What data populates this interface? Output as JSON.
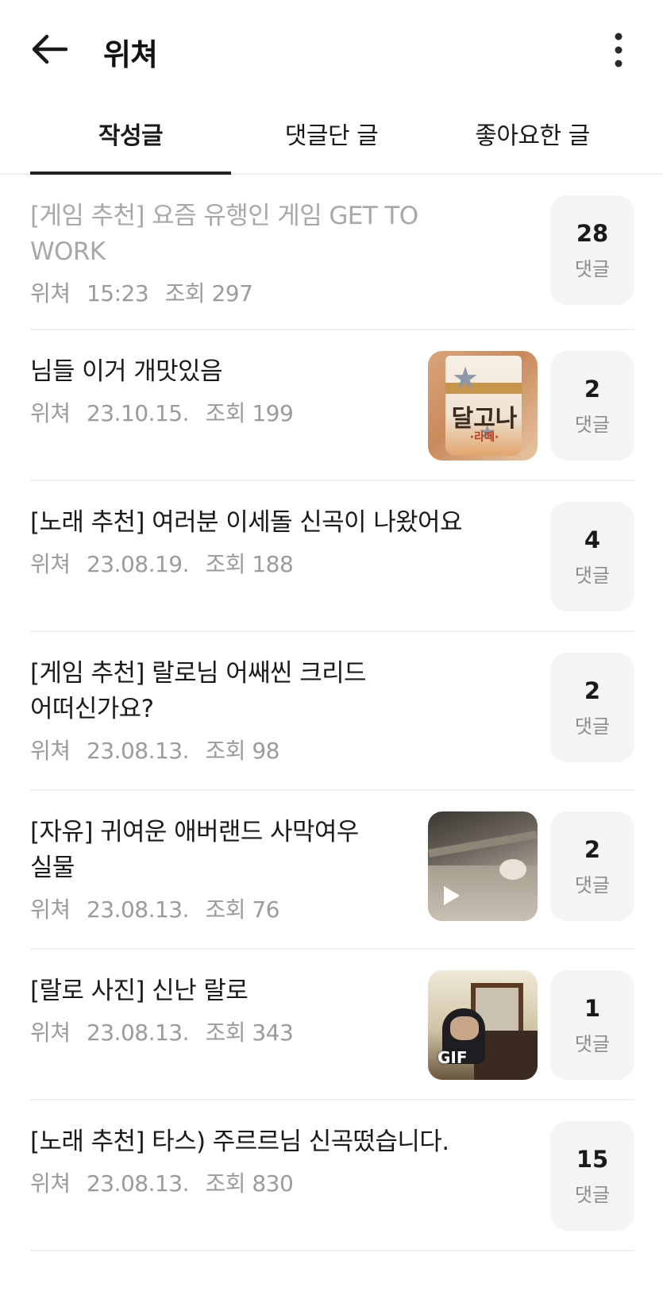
{
  "header": {
    "title": "위쳐",
    "back_icon": "arrow-left-icon",
    "more_icon": "more-vertical-icon"
  },
  "tabs": [
    {
      "label": "작성글",
      "active": true
    },
    {
      "label": "댓글단 글",
      "active": false
    },
    {
      "label": "좋아요한 글",
      "active": false
    }
  ],
  "posts": [
    {
      "title_lines": [
        "[게임 추천] 요즘 유행인 게임 GET TO",
        "WORK"
      ],
      "author": "위쳐",
      "date": "15:23",
      "views": "조회 297",
      "comments": "28",
      "comments_label": "댓글",
      "read": true,
      "thumbnail": null
    },
    {
      "title_lines": [
        "님들 이거 개맛있음"
      ],
      "author": "위쳐",
      "date": "23.10.15.",
      "views": "조회 199",
      "comments": "2",
      "comments_label": "댓글",
      "read": false,
      "thumbnail": {
        "kind": "photo",
        "text": "달고나",
        "subtext": "·라떼·"
      }
    },
    {
      "title_lines": [
        "[노래 추천] 여러분 이세돌 신곡이 나왔어요"
      ],
      "author": "위쳐",
      "date": "23.08.19.",
      "views": "조회 188",
      "comments": "4",
      "comments_label": "댓글",
      "read": false,
      "thumbnail": null
    },
    {
      "title_lines": [
        "[게임 추천] 랄로님 어쌔씬 크리드",
        "어떠신가요?"
      ],
      "author": "위쳐",
      "date": "23.08.13.",
      "views": "조회 98",
      "comments": "2",
      "comments_label": "댓글",
      "read": false,
      "thumbnail": null
    },
    {
      "title_lines": [
        "[자유] 귀여운 애버랜드 사막여우",
        "실물"
      ],
      "author": "위쳐",
      "date": "23.08.13.",
      "views": "조회 76",
      "comments": "2",
      "comments_label": "댓글",
      "read": false,
      "thumbnail": {
        "kind": "video"
      }
    },
    {
      "title_lines": [
        "[랄로 사진] 신난 랄로"
      ],
      "author": "위쳐",
      "date": "23.08.13.",
      "views": "조회 343",
      "comments": "1",
      "comments_label": "댓글",
      "read": false,
      "thumbnail": {
        "kind": "gif",
        "label": "GIF"
      }
    },
    {
      "title_lines": [
        "[노래 추천] 타스) 주르르님 신곡떴습니다."
      ],
      "author": "위쳐",
      "date": "23.08.13.",
      "views": "조회 830",
      "comments": "15",
      "comments_label": "댓글",
      "read": false,
      "thumbnail": null
    }
  ]
}
